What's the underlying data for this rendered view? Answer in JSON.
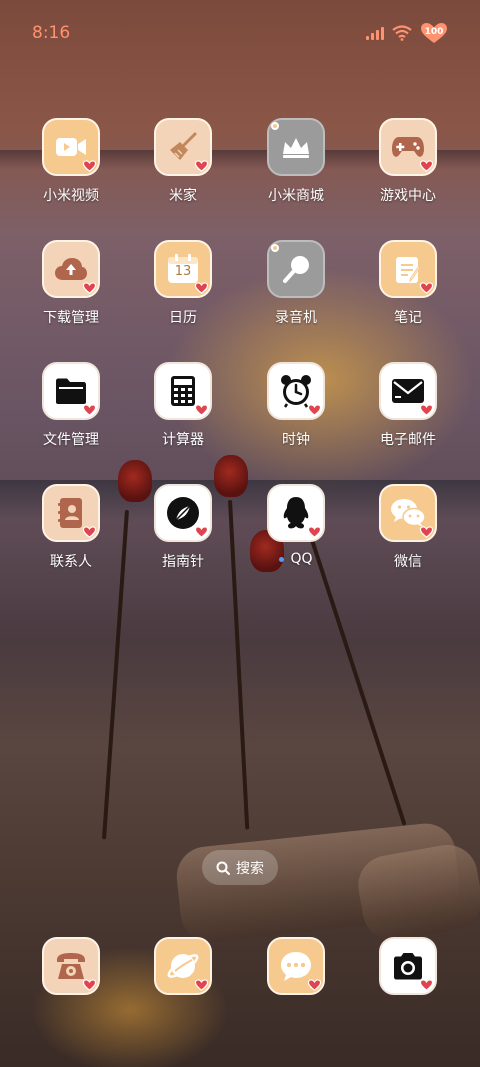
{
  "status_bar": {
    "time": "8:16",
    "battery": "100",
    "accent_color": "#ff9270"
  },
  "apps": [
    {
      "label": "小米视频",
      "icon": "video-icon"
    },
    {
      "label": "米家",
      "icon": "broom-icon"
    },
    {
      "label": "小米商城",
      "icon": "crown-icon"
    },
    {
      "label": "游戏中心",
      "icon": "gamepad-icon"
    },
    {
      "label": "下载管理",
      "icon": "cloud-upload-icon"
    },
    {
      "label": "日历",
      "icon": "calendar-icon",
      "day": "13"
    },
    {
      "label": "录音机",
      "icon": "microphone-icon"
    },
    {
      "label": "笔记",
      "icon": "notepad-icon"
    },
    {
      "label": "文件管理",
      "icon": "folder-icon"
    },
    {
      "label": "计算器",
      "icon": "calculator-icon"
    },
    {
      "label": "时钟",
      "icon": "alarm-clock-icon"
    },
    {
      "label": "电子邮件",
      "icon": "mail-icon"
    },
    {
      "label": "联系人",
      "icon": "contacts-book-icon"
    },
    {
      "label": "指南针",
      "icon": "compass-icon"
    },
    {
      "label": "QQ",
      "icon": "penguin-icon"
    },
    {
      "label": "微信",
      "icon": "wechat-icon"
    }
  ],
  "search": {
    "label": "搜索"
  },
  "dock": [
    {
      "icon": "phone-icon"
    },
    {
      "icon": "browser-planet-icon"
    },
    {
      "icon": "message-bubble-icon"
    },
    {
      "icon": "camera-icon"
    }
  ],
  "colors": {
    "icon_orange": "#f6c98e",
    "icon_peach": "#f3d4b8",
    "heart": "#e0444f",
    "notify_dot": "#4f9cff"
  }
}
